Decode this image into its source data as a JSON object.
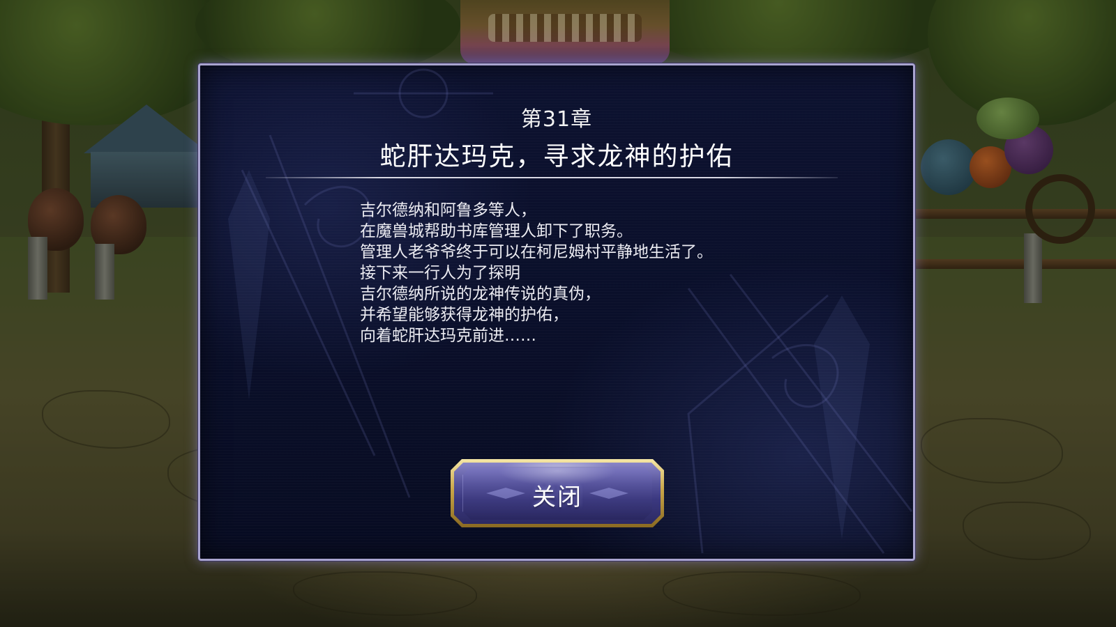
{
  "dialog": {
    "chapter": "第31章",
    "title": "蛇肝达玛克，寻求龙神的护佑",
    "body_lines": [
      "吉尔德纳和阿鲁多等人，",
      "在魔兽城帮助书库管理人卸下了职务。",
      "管理人老爷爷终于可以在柯尼姆村平静地生活了。",
      "接下来一行人为了探明",
      "吉尔德纳所说的龙神传说的真伪，",
      "并希望能够获得龙神的护佑，",
      "向着蛇肝达玛克前进……"
    ],
    "close_label": "关闭"
  },
  "colors": {
    "panel_bg": "#0b1029",
    "panel_border": "#a9a4cf",
    "button_gold": "#c9a548",
    "button_face": "#3b3880",
    "text": "#ececf2"
  }
}
